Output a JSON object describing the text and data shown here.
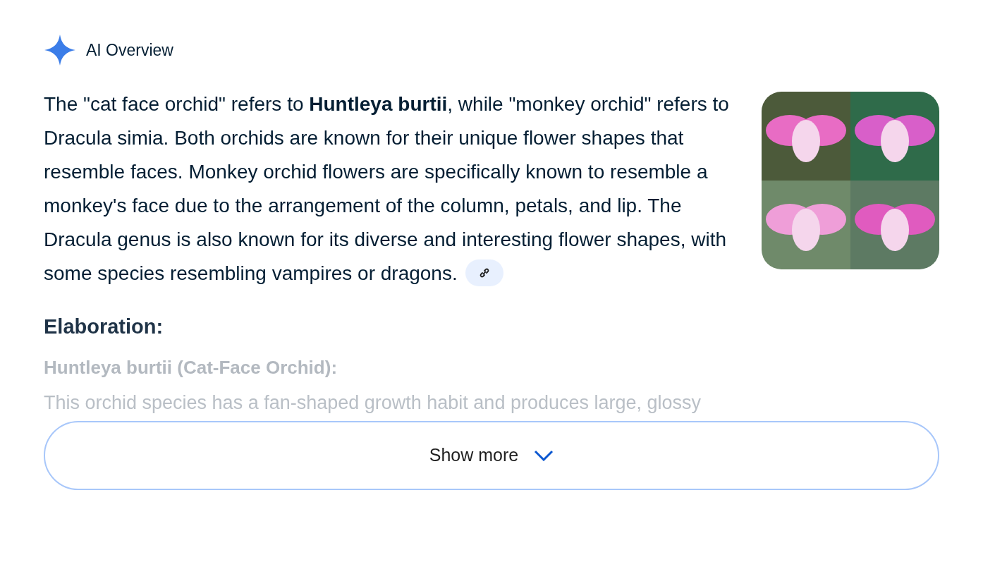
{
  "header": {
    "title": "AI Overview"
  },
  "answer": {
    "text": "The \"cat face orchid\" refers to **Huntleya burtii**, while \"monkey orchid\" refers to Dracula simia. Both orchids are known for their unique flower shapes that resemble faces. Monkey orchid flowers are specifically known to resemble a monkey's face due to the arrangement of the column, petals, and lip. The Dracula genus is also known for its diverse and interesting flower shapes, with some species resembling vampires or dragons."
  },
  "elaboration": {
    "heading": "Elaboration:",
    "subheading": "Huntleya burtii (Cat-Face Orchid):",
    "text": "This orchid species has a fan-shaped growth habit and produces large, glossy"
  },
  "show_more": {
    "label": "Show more"
  }
}
